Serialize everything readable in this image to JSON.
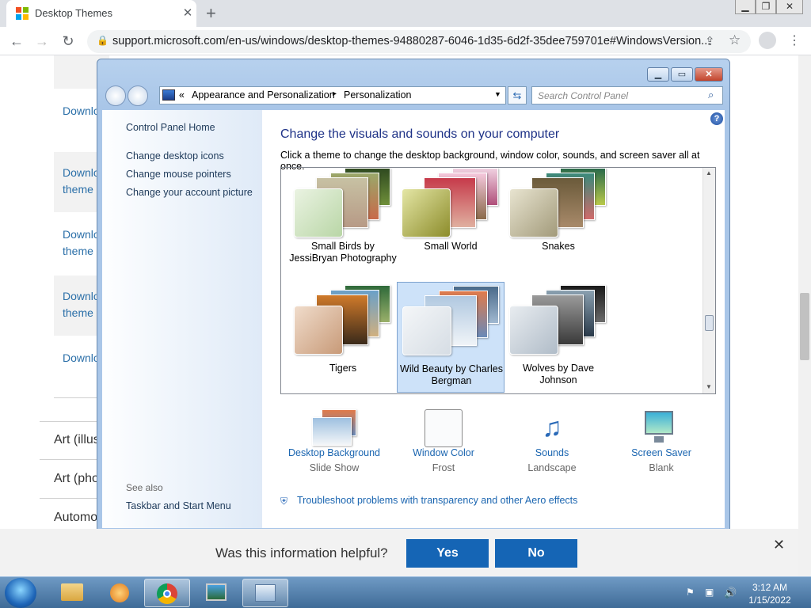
{
  "browser": {
    "tab_title": "Desktop Themes",
    "url": "support.microsoft.com/en-us/windows/desktop-themes-94880287-6046-1d35-6d2f-35dee759701e#WindowsVersion..."
  },
  "page": {
    "links": [
      "Downlo",
      "Downlo",
      "theme",
      "Downlo",
      "theme",
      "Downlo",
      "theme",
      "Downlo"
    ],
    "categories": [
      "Art (illus",
      "Art (pho",
      "Automo"
    ]
  },
  "dialog": {
    "breadcrumb": {
      "chev": "«",
      "part1": "Appearance and Personalization",
      "sep": "▸",
      "part2": "Personalization"
    },
    "search_placeholder": "Search Control Panel",
    "left": {
      "home": "Control Panel Home",
      "links": [
        "Change desktop icons",
        "Change mouse pointers",
        "Change your account picture"
      ],
      "see_also": "See also",
      "see_also_link": "Taskbar and Start Menu"
    },
    "heading": "Change the visuals and sounds on your computer",
    "subheading": "Click a theme to change the desktop background, window color, sounds, and screen saver all at once.",
    "themes": [
      {
        "label": "Small Birds by JessiBryan Photography"
      },
      {
        "label": "Small World"
      },
      {
        "label": "Snakes"
      },
      {
        "label": "Tigers"
      },
      {
        "label": "Wild Beauty by Charles Bergman",
        "selected": true
      },
      {
        "label": "Wolves by Dave Johnson"
      }
    ],
    "bottom": [
      {
        "label": "Desktop Background",
        "sub": "Slide Show"
      },
      {
        "label": "Window Color",
        "sub": "Frost"
      },
      {
        "label": "Sounds",
        "sub": "Landscape"
      },
      {
        "label": "Screen Saver",
        "sub": "Blank"
      }
    ],
    "troubleshoot": "Troubleshoot problems with transparency and other Aero effects"
  },
  "helpful": {
    "question": "Was this information helpful?",
    "yes": "Yes",
    "no": "No"
  },
  "taskbar": {
    "time": "3:12 AM",
    "date": "1/15/2022"
  }
}
